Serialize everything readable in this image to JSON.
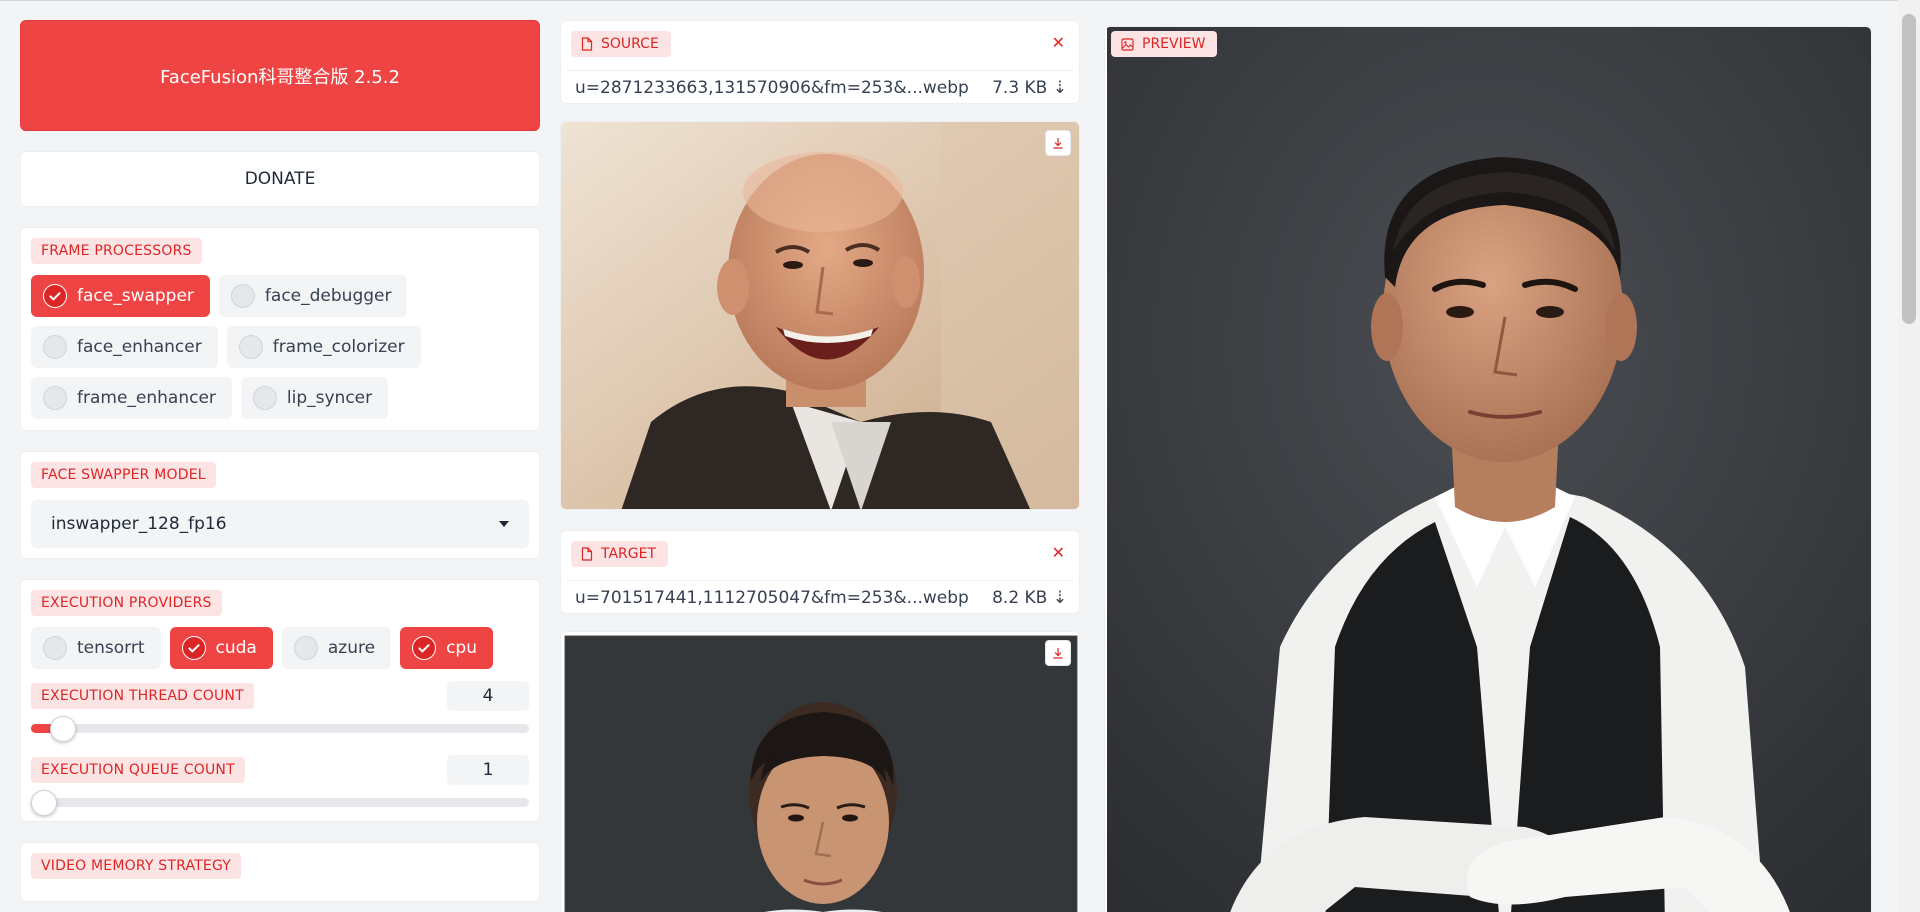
{
  "app": {
    "title": "FaceFusion科哥整合版 2.5.2",
    "donate_label": "DONATE"
  },
  "frame_processors": {
    "label": "FRAME PROCESSORS",
    "options": [
      {
        "label": "face_swapper",
        "checked": true
      },
      {
        "label": "face_debugger",
        "checked": false
      },
      {
        "label": "face_enhancer",
        "checked": false
      },
      {
        "label": "frame_colorizer",
        "checked": false
      },
      {
        "label": "frame_enhancer",
        "checked": false
      },
      {
        "label": "lip_syncer",
        "checked": false
      }
    ]
  },
  "face_swapper_model": {
    "label": "FACE SWAPPER MODEL",
    "value": "inswapper_128_fp16"
  },
  "execution_providers": {
    "label": "EXECUTION PROVIDERS",
    "options": [
      {
        "label": "tensorrt",
        "checked": false
      },
      {
        "label": "cuda",
        "checked": true
      },
      {
        "label": "azure",
        "checked": false
      },
      {
        "label": "cpu",
        "checked": true
      }
    ]
  },
  "thread_count": {
    "label": "EXECUTION THREAD COUNT",
    "value": "4",
    "fraction": 0.04
  },
  "queue_count": {
    "label": "EXECUTION QUEUE COUNT",
    "value": "1",
    "fraction": 0.0
  },
  "video_memory": {
    "label": "VIDEO MEMORY STRATEGY"
  },
  "source": {
    "label": "SOURCE",
    "filename": "u=2871233663,131570906&fm=253&...webp",
    "size": "7.3 KB ⇣"
  },
  "target": {
    "label": "TARGET",
    "filename": "u=701517441,1112705047&fm=253&...webp",
    "size": "8.2 KB ⇣"
  },
  "preview": {
    "label": "PREVIEW"
  },
  "colors": {
    "accent": "#ef4444",
    "tag_bg": "#fde4e4",
    "tag_text": "#dc2626"
  }
}
